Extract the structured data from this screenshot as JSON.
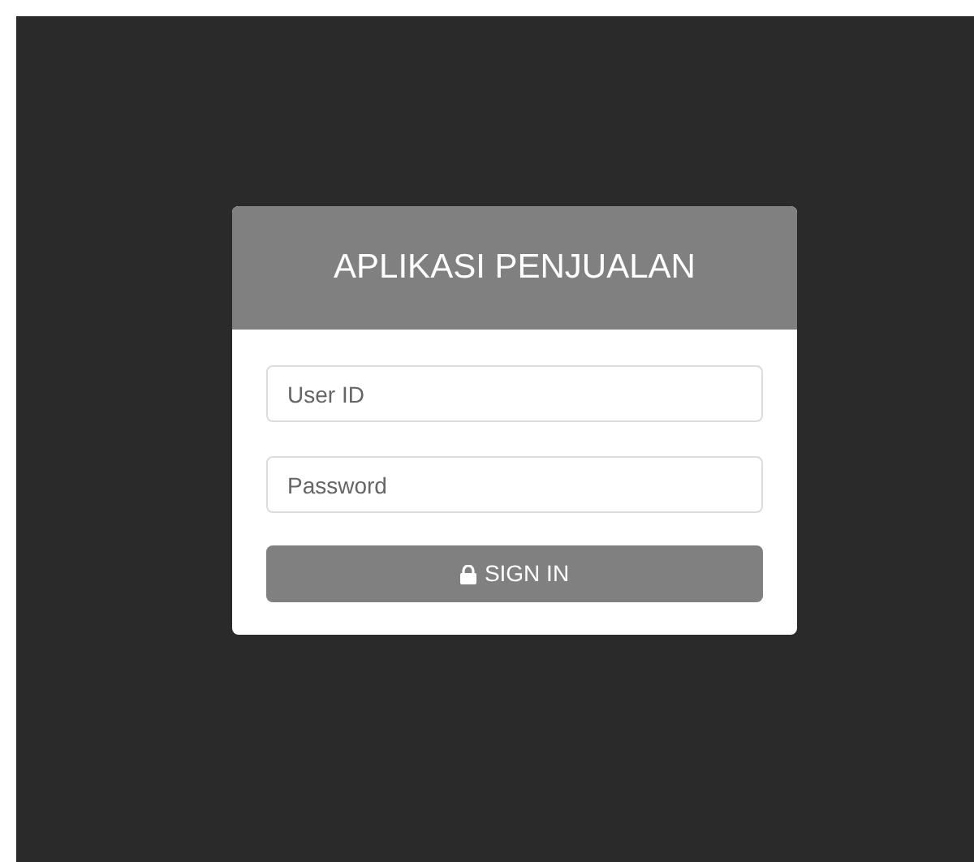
{
  "login": {
    "title": "APLIKASI PENJUALAN",
    "fields": [
      {
        "placeholder": "User ID"
      },
      {
        "placeholder": "Password"
      }
    ],
    "button": "SIGN IN"
  }
}
